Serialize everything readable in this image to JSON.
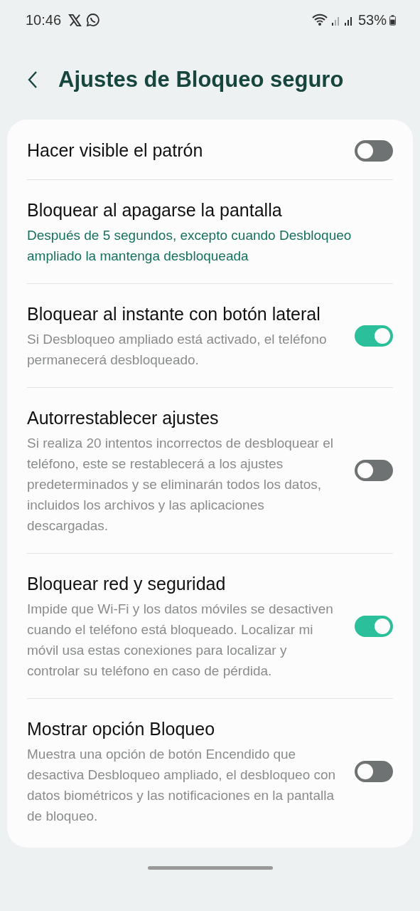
{
  "status_bar": {
    "time": "10:46",
    "battery_text": "53%"
  },
  "header": {
    "title": "Ajustes de Bloqueo seguro"
  },
  "settings": [
    {
      "kind": "switch",
      "title": "Hacer visible el patrón",
      "on": false
    },
    {
      "kind": "option",
      "title": "Bloquear al apagarse la pantalla",
      "summary": "Después de 5 segundos, excepto cuando Desbloqueo ampliado la mantenga desbloqueada"
    },
    {
      "kind": "switch",
      "title": "Bloquear al instante con botón lateral",
      "summary": "Si Desbloqueo ampliado está activado, el teléfono permanecerá desbloqueado.",
      "on": true
    },
    {
      "kind": "switch",
      "title": "Autorrestablecer ajustes",
      "summary": "Si realiza 20 intentos incorrectos de desbloquear el teléfono, este se restablecerá a los ajustes predeterminados y se eliminarán todos los datos, incluidos los archivos y las aplicaciones descargadas.",
      "on": false
    },
    {
      "kind": "switch",
      "title": "Bloquear red y seguridad",
      "summary": "Impide que Wi-Fi y los datos móviles se desactiven cuando el teléfono está bloqueado. Localizar mi móvil usa estas conexiones para localizar y controlar su teléfono en caso de pérdida.",
      "on": true
    },
    {
      "kind": "switch",
      "title": "Mostrar opción Bloqueo",
      "summary": "Muestra una opción de botón Encendido que desactiva Desbloqueo ampliado, el desbloqueo con datos biométricos y las notificaciones en la pantalla de bloqueo.",
      "on": false
    }
  ]
}
